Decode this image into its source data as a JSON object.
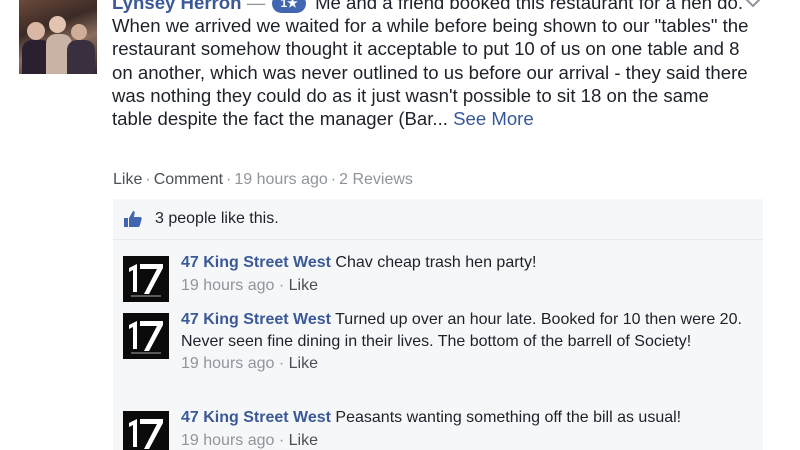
{
  "post": {
    "author": "Lynsey Herron",
    "dash": "—",
    "badge": "1★",
    "text": "Me and a friend booked this restaurant for a hen do. When we arrived we waited for a while before being shown to our \"tables\" the restaurant somehow thought it acceptable to put 10 of us on one table and 8 on another, which was never outlined to us before our arrival - they said there was nothing they could do as it just wasn't possible to sit 18 on the same table despite the fact the manager (Bar...",
    "see_more": "See More",
    "actions": {
      "like": "Like",
      "comment": "Comment",
      "time": "19 hours ago",
      "reviews": "2 Reviews",
      "sep": "·"
    }
  },
  "likes": {
    "text": "3 people like this."
  },
  "comments": [
    {
      "author": "47 King Street West",
      "text": "Chav cheap trash hen party!",
      "time": "19 hours ago",
      "like": "Like",
      "sep": "·"
    },
    {
      "author": "47 King Street West",
      "text": "Turned up over an hour late. Booked for 10 then were 20. Never seen fine dining in their lives. The bottom of the barrell of Society!",
      "time": "19 hours ago",
      "like": "Like",
      "sep": "·"
    },
    {
      "author": "47 King Street West",
      "text": "Peasants wanting something off the bill as usual!",
      "time": "19 hours ago",
      "like": "Like",
      "sep": "·"
    }
  ],
  "icons": {
    "avatar": "user-photo",
    "chevron": "chevron-down-icon",
    "thumb": "thumbs-up-icon",
    "page_logo": "page-logo-47"
  },
  "colors": {
    "link": "#3b5998",
    "muted": "#90949c",
    "badge": "#4267b2",
    "comment_bg": "#f6f7f9"
  }
}
